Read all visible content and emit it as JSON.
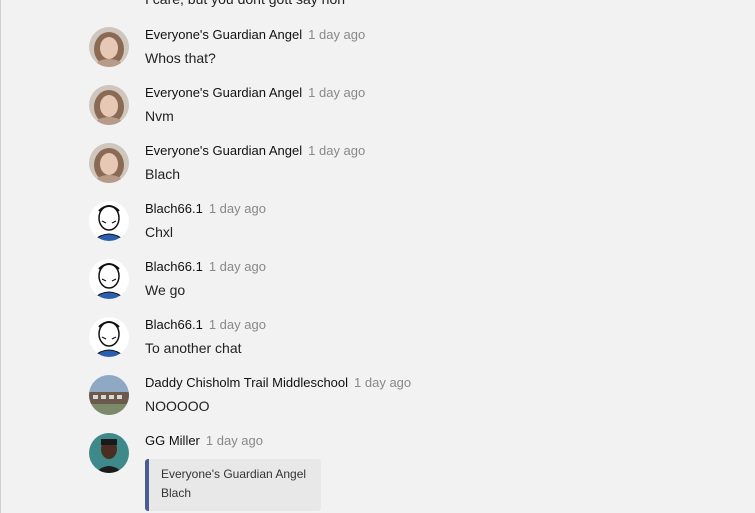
{
  "chat": {
    "partial_message": "I care, but you dont gott say hoh",
    "messages": [
      {
        "author": "Everyone's Guardian Angel",
        "time": "1 day ago",
        "text": "Whos that?",
        "avatar": "angel-avatar"
      },
      {
        "author": "Everyone's Guardian Angel",
        "time": "1 day ago",
        "text": "Nvm",
        "avatar": "angel-avatar"
      },
      {
        "author": "Everyone's Guardian Angel",
        "time": "1 day ago",
        "text": "Blach",
        "avatar": "angel-avatar"
      },
      {
        "author": "Blach66.1",
        "time": "1 day ago",
        "text": "Chxl",
        "avatar": "sketch-face-avatar"
      },
      {
        "author": "Blach66.1",
        "time": "1 day ago",
        "text": "We go",
        "avatar": "sketch-face-avatar"
      },
      {
        "author": "Blach66.1",
        "time": "1 day ago",
        "text": "To another chat",
        "avatar": "sketch-face-avatar"
      },
      {
        "author": "Daddy Chisholm Trail Middleschool",
        "time": "1 day ago",
        "text": "NOOOOO",
        "avatar": "school-building-avatar"
      },
      {
        "author": "GG Miller",
        "time": "1 day ago",
        "avatar": "person-avatar",
        "reply": {
          "author": "Everyone's Guardian Angel",
          "text": "Blach"
        }
      }
    ]
  },
  "colors": {
    "background": "#f2f2f2",
    "quote_bar": "#4a5c94",
    "timestamp": "#888888"
  }
}
